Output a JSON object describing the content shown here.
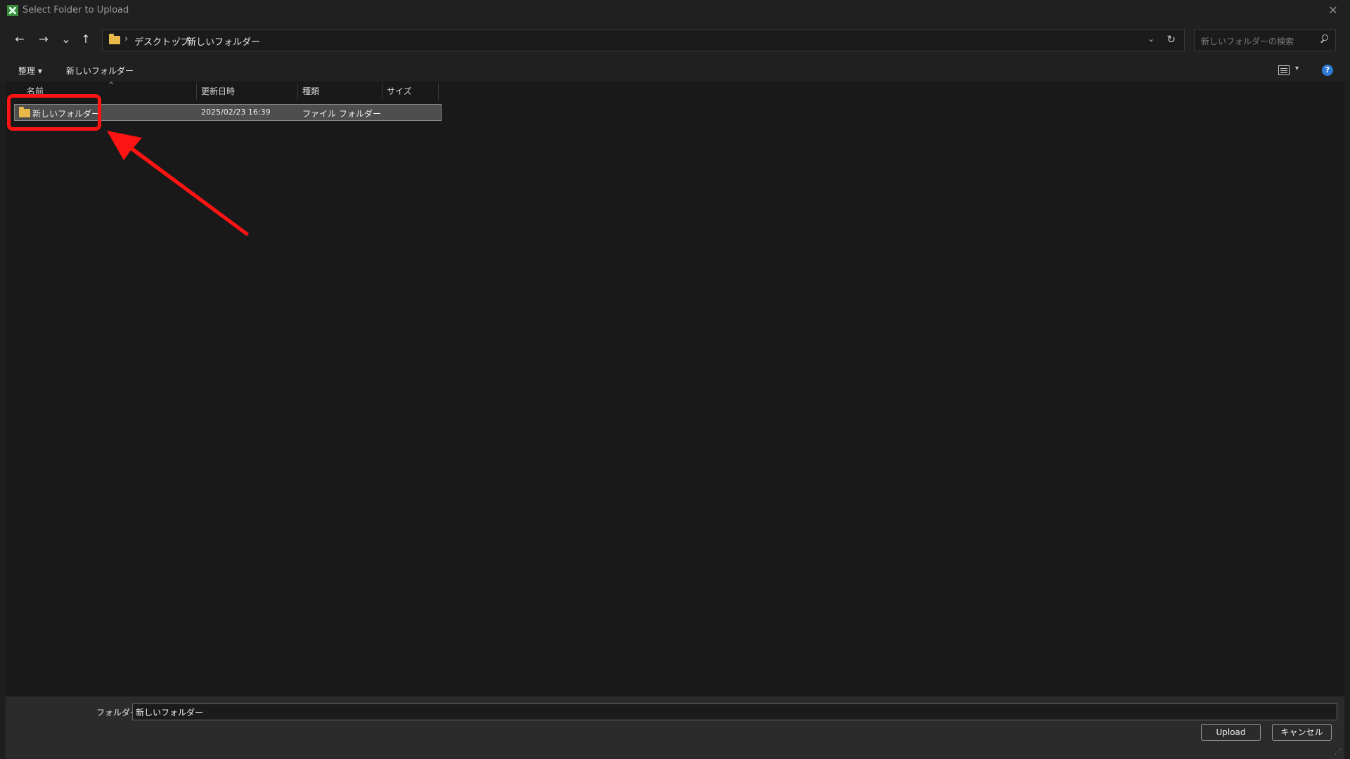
{
  "window": {
    "title": "Select Folder to Upload",
    "close_glyph": "✕"
  },
  "nav": {
    "back_glyph": "←",
    "forward_glyph": "→",
    "recent_glyph": "⌄",
    "up_glyph": "↑"
  },
  "address": {
    "crumbs": [
      "デスクトップ",
      "新しいフォルダー"
    ],
    "separator": "›",
    "dropdown_glyph": "⌄",
    "refresh_glyph": "↻"
  },
  "search": {
    "placeholder": "新しいフォルダーの検索"
  },
  "toolbar": {
    "organize_label": "整理 ▾",
    "new_folder_label": "新しいフォルダー",
    "view_caret": "▾",
    "help_glyph": "?"
  },
  "columns": {
    "name": "名前",
    "modified": "更新日時",
    "type": "種類",
    "size": "サイズ",
    "sort_glyph": "^"
  },
  "rows": [
    {
      "name": "新しいフォルダー",
      "modified": "2025/02/23 16:39",
      "type": "ファイル フォルダー",
      "size": ""
    }
  ],
  "footer": {
    "folder_label": "フォルダー:",
    "folder_value": "新しいフォルダー",
    "upload_label": "Upload",
    "cancel_label": "キャンセル"
  },
  "colors": {
    "annotation": "#ff1414",
    "folder_icon": "#e8b84a",
    "help_icon": "#2d7bd6"
  }
}
